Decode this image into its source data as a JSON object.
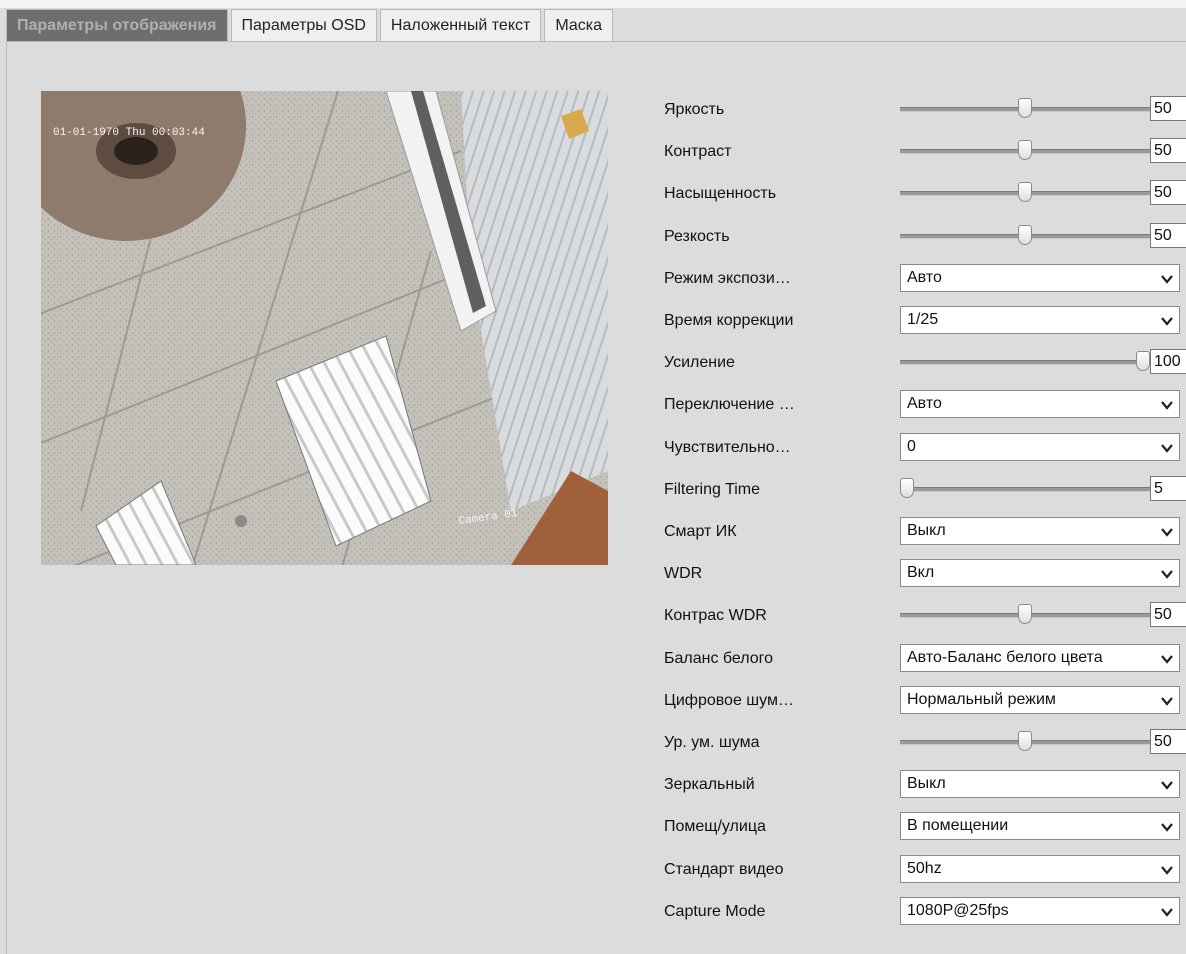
{
  "tabs": [
    {
      "label": "Параметры отображения",
      "active": true
    },
    {
      "label": "Параметры OSD",
      "active": false
    },
    {
      "label": "Наложенный текст",
      "active": false
    },
    {
      "label": "Маска",
      "active": false
    }
  ],
  "preview": {
    "osd_datetime": "01-01-1970 Thu 00:03:44",
    "osd_camera": "Camera 01"
  },
  "settings": [
    {
      "id": "brightness",
      "label": "Яркость",
      "type": "slider",
      "value": "50",
      "fraction": 0.5
    },
    {
      "id": "contrast",
      "label": "Контраст",
      "type": "slider",
      "value": "50",
      "fraction": 0.5
    },
    {
      "id": "saturation",
      "label": "Насыщенность",
      "type": "slider",
      "value": "50",
      "fraction": 0.5
    },
    {
      "id": "sharpness",
      "label": "Резкость",
      "type": "slider",
      "value": "50",
      "fraction": 0.5
    },
    {
      "id": "exposure_mode",
      "label": "Режим экспози…",
      "type": "select",
      "value": "Авто"
    },
    {
      "id": "correction_time",
      "label": "Время коррекции",
      "type": "select",
      "value": "1/25"
    },
    {
      "id": "gain",
      "label": "Усиление",
      "type": "slider",
      "value": "100",
      "fraction": 1.0
    },
    {
      "id": "switch_mode",
      "label": "Переключение …",
      "type": "select",
      "value": "Авто"
    },
    {
      "id": "sensitivity",
      "label": "Чувствительно…",
      "type": "select",
      "value": "0"
    },
    {
      "id": "filtering_time",
      "label": "Filtering Time",
      "type": "slider",
      "value": "5",
      "fraction": 0.0
    },
    {
      "id": "smart_ir",
      "label": "Смарт ИК",
      "type": "select",
      "value": "Выкл"
    },
    {
      "id": "wdr",
      "label": "WDR",
      "type": "select",
      "value": "Вкл"
    },
    {
      "id": "wdr_contrast",
      "label": "Контрас WDR",
      "type": "slider",
      "value": "50",
      "fraction": 0.5
    },
    {
      "id": "white_balance",
      "label": "Баланс белого",
      "type": "select",
      "value": "Авто-Баланс белого цвета"
    },
    {
      "id": "digital_noise",
      "label": "Цифровое шум…",
      "type": "select",
      "value": "Нормальный режим"
    },
    {
      "id": "noise_level",
      "label": "Ур. ум. шума",
      "type": "slider",
      "value": "50",
      "fraction": 0.5
    },
    {
      "id": "mirror",
      "label": "Зеркальный",
      "type": "select",
      "value": "Выкл"
    },
    {
      "id": "indoor_outdoor",
      "label": "Помещ/улица",
      "type": "select",
      "value": "В помещении"
    },
    {
      "id": "video_standard",
      "label": "Стандарт видео",
      "type": "select",
      "value": "50hz"
    },
    {
      "id": "capture_mode",
      "label": "Capture Mode",
      "type": "select",
      "value": "1080P@25fps"
    }
  ]
}
